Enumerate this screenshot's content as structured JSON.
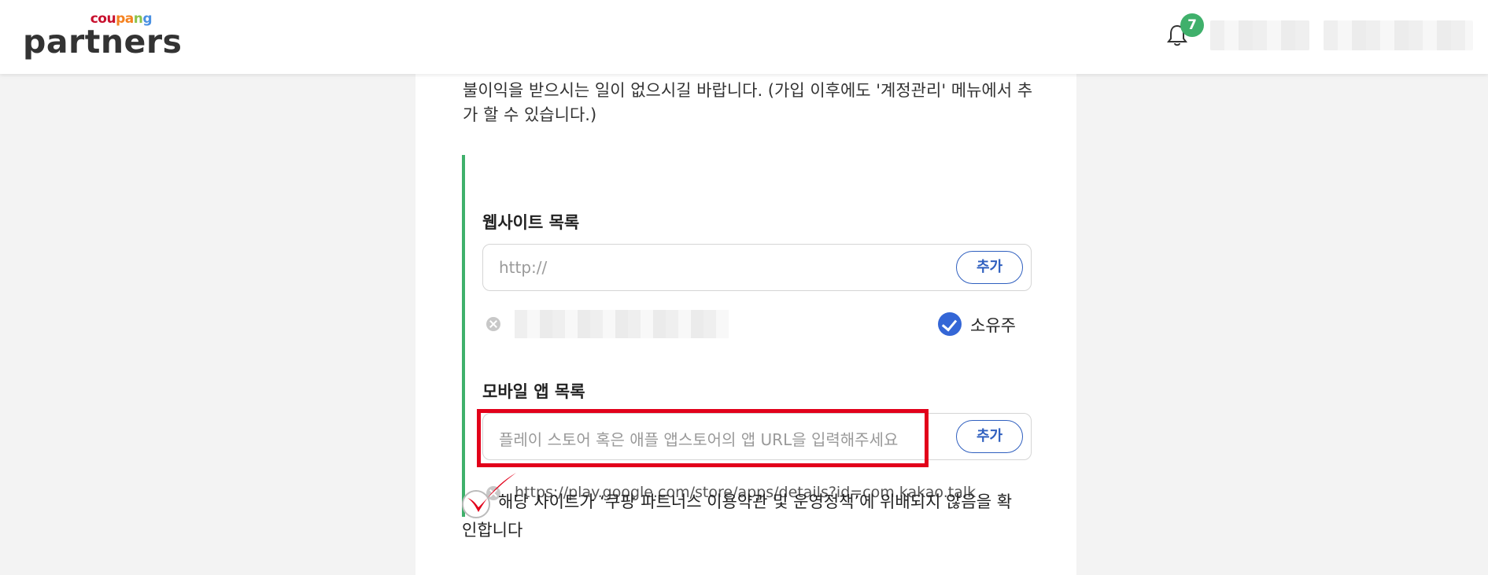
{
  "header": {
    "logo_small": "coupang",
    "logo_main": "partners",
    "notification_count": "7",
    "brand_colors": [
      "#c8102e",
      "#f58220",
      "#8bc34a",
      "#4a90e2"
    ]
  },
  "intro": {
    "text": "불이익을 받으시는 일이 없으시길 바랍니다. (가입 이후에도 '계정관리' 메뉴에서 추가 할 수 있습니다.)"
  },
  "website": {
    "title": "웹사이트 목록",
    "placeholder": "http://",
    "add_label": "추가",
    "owner_label": "소유주"
  },
  "mobile_app": {
    "title": "모바일 앱 목록",
    "placeholder": "플레이 스토어 혹은 애플 앱스토어의 앱 URL을 입력해주세요",
    "add_label": "추가",
    "url": "https://play.google.com/store/apps/details?id=com.kakao.talk"
  },
  "agreement": {
    "text": "해당 사이트가 ‘쿠팡 파트너스 이용약관 및 운영정책’에 위배되지 않음을 확인합니다"
  },
  "colors": {
    "accent_green": "#3fb06b",
    "button_blue": "#2f5fbf",
    "highlight_red": "#e2001a"
  }
}
